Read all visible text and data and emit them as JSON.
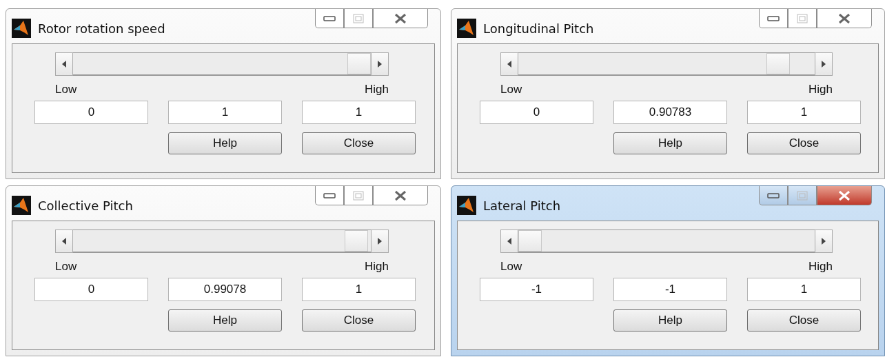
{
  "windows": [
    {
      "title": "Rotor rotation speed",
      "active": false,
      "slider": {
        "level": 1
      },
      "low_label": "Low",
      "high_label": "High",
      "fields": [
        "0",
        "1",
        "1"
      ],
      "buttons": [
        "Help",
        "Close"
      ]
    },
    {
      "title": "Longitudinal Pitch",
      "active": false,
      "slider": {
        "level": 0.91
      },
      "low_label": "Low",
      "high_label": "High",
      "fields": [
        "0",
        "0.90783",
        "1"
      ],
      "buttons": [
        "Help",
        "Close"
      ]
    },
    {
      "title": "Collective Pitch",
      "active": false,
      "slider": {
        "level": 0.99
      },
      "low_label": "Low",
      "high_label": "High",
      "fields": [
        "0",
        "0.99078",
        "1"
      ],
      "buttons": [
        "Help",
        "Close"
      ]
    },
    {
      "title": "Lateral  Pitch",
      "active": true,
      "slider": {
        "level": 0
      },
      "low_label": "Low",
      "high_label": "High",
      "fields": [
        "-1",
        "-1",
        "1"
      ],
      "buttons": [
        "Help",
        "Close"
      ]
    }
  ]
}
